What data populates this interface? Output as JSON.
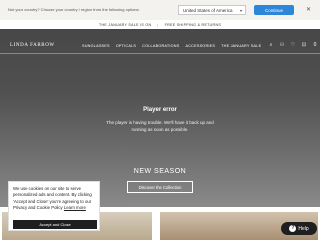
{
  "country_bar": {
    "prompt": "Not your country? Choose your country / region from the following options:",
    "selected_country": "United States of America",
    "continue_label": "Continue",
    "close_glyph": "✕"
  },
  "promo": {
    "items": [
      "THE JANUARY SALE IS ON",
      "FREE SHIPPING & RETURNS"
    ],
    "separator": "|"
  },
  "header": {
    "logo": "LINDA FARROW",
    "nav": [
      "SUNGLASSES",
      "OPTICALS",
      "COLLABORATIONS",
      "ACCESSORIES",
      "THE JANUARY SALE"
    ],
    "icons": [
      "search-icon",
      "account-icon",
      "wishlist-icon",
      "bag-icon",
      "cart-count-icon"
    ],
    "icon_glyphs": {
      "search": "⌕",
      "account": "⚇",
      "wishlist": "♡",
      "bag": "⊡",
      "count": "0"
    }
  },
  "hero": {
    "error_title": "Player error",
    "error_message": "The player is having trouble. We'll have it back up and running as soon as possible.",
    "headline": "NEW SEASON",
    "cta": "Discover the Collection"
  },
  "cookie": {
    "text_before": "We use cookies on our site to serve personalized ads and content. By clicking 'Accept and Close' you're agreeing to our Privacy and Cookie Policy ",
    "link": "Learn more",
    "accept_label": "Accept and Close"
  },
  "help": {
    "label": "Help",
    "glyph": "?"
  }
}
